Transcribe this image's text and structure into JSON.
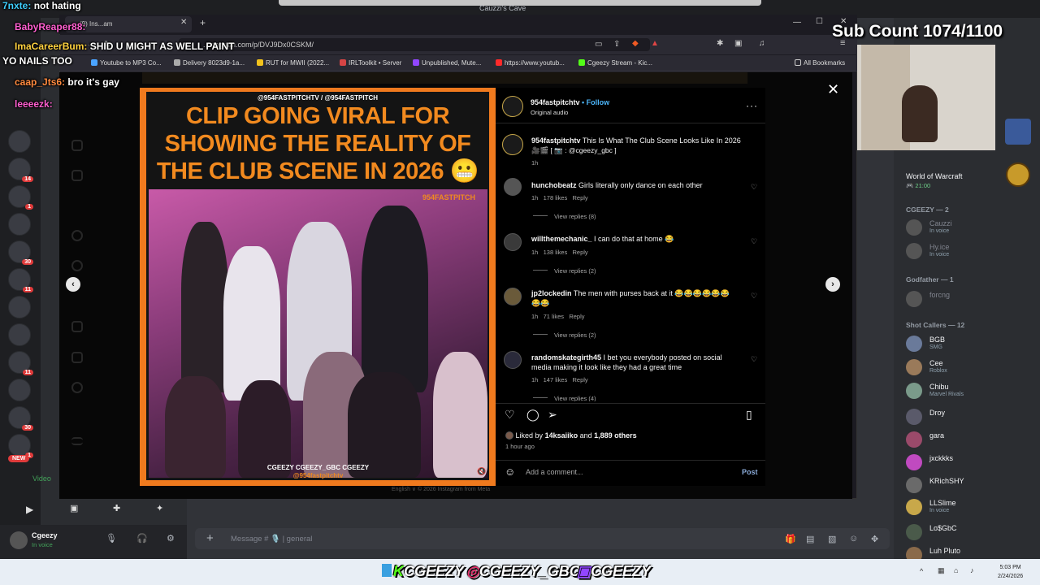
{
  "window": {
    "title": "Cauzzi's Cave"
  },
  "overlay": {
    "sub_count": "Sub Count 1074/1100",
    "chat": [
      {
        "user": "7nxte:",
        "message": "not hating"
      },
      {
        "user": "BabyReaper88:",
        "message": ""
      },
      {
        "user": "ImaCareerBum:",
        "message": "SHID U MIGHT AS WELL PAINT"
      },
      {
        "user": "",
        "message": "YO NAILS TOO"
      },
      {
        "user": "caap_Jts6:",
        "message": "bro it's gay"
      },
      {
        "user": "leeeezk:",
        "message": ""
      }
    ]
  },
  "browser": {
    "tab_title": "(9) Ins...am",
    "url": "...stagram.com/p/DVJ9Dx0CSKM/",
    "bookmarks": [
      "Youtube to MP3 Co...",
      "Delivery 8023d9-1a...",
      "RUT for MWII (2022...",
      "IRLToolkit • Server",
      "Unpublished, Mute...",
      "https://www.youtub...",
      "Cgeezy Stream - Kic..."
    ],
    "all_bookmarks": "All Bookmarks"
  },
  "video": {
    "handles": "@954FASTPITCHTV / @954FASTPITCH",
    "headline": "CLIP GOING VIRAL FOR SHOWING THE REALITY OF THE CLUB SCENE IN 2026 😬",
    "brand": "954FASTPITCH",
    "caption": "CGEEZY  CGEEZY_GBC  CGEEZY",
    "caption2": "@954fastpitchtv"
  },
  "post": {
    "author": "954fastpitchtv",
    "follow_label": "Follow",
    "audio": "Original audio",
    "caption_user": "954fastpitchtv",
    "caption_text": "This Is What The Club Scene Looks Like In 2026",
    "caption_line2": "🎥🎬 [ 📷 : @cgeezy_gbc ]",
    "caption_time": "1h",
    "comments": [
      {
        "user": "hunchobeatz",
        "text": "Girls literally only dance on each other",
        "time": "1h",
        "likes": "178 likes",
        "reply": "Reply",
        "view_replies": "View replies (8)"
      },
      {
        "user": "willthemechanic_",
        "text": "I can do that at home 😂",
        "time": "1h",
        "likes": "138 likes",
        "reply": "Reply",
        "view_replies": "View replies (2)"
      },
      {
        "user": "jp2lockedin",
        "text": "The men with purses back at it 😂😂😂😂😂😂",
        "text2": "😂😂",
        "time": "1h",
        "likes": "71 likes",
        "reply": "Reply",
        "view_replies": "View replies (2)"
      },
      {
        "user": "randomskategirth45",
        "text": "I bet you everybody posted on social",
        "text2": "media making it look like they had a great time",
        "time": "1h",
        "likes": "147 likes",
        "reply": "Reply",
        "view_replies": "View replies (4)"
      }
    ],
    "liked_by_prefix": "Liked by",
    "liked_by_user": "14ksaiiko",
    "liked_by_mid": "and",
    "liked_by_others": "1,889 others",
    "posted_ago": "1 hour ago",
    "comment_placeholder": "Add a comment...",
    "post_label": "Post",
    "footer": "English ∨   © 2026 Instagram from Meta"
  },
  "discord": {
    "game_activity": "World of Warcraft",
    "game_sub": "🎮 21:00",
    "groups": [
      {
        "heading": "CGEEZY — 2",
        "members": [
          {
            "name": "Cauzzi",
            "sub": "In voice"
          },
          {
            "name": "Hy.ice",
            "sub": "In voice"
          }
        ]
      },
      {
        "heading": "Godfather — 1",
        "members": [
          {
            "name": "forcng",
            "sub": ""
          }
        ]
      },
      {
        "heading": "Shot Callers — 12",
        "members": [
          {
            "name": "BGB",
            "sub": "SMG"
          },
          {
            "name": "Cee",
            "sub": "Roblox"
          },
          {
            "name": "Chibu",
            "sub": "Marvel Rivals"
          },
          {
            "name": "Droy",
            "sub": ""
          },
          {
            "name": "gara",
            "sub": ""
          },
          {
            "name": "jxckkks",
            "sub": ""
          },
          {
            "name": "KRichSHY",
            "sub": ""
          },
          {
            "name": "LLSlime",
            "sub": "In voice"
          },
          {
            "name": "Lo$GbC",
            "sub": ""
          },
          {
            "name": "Luh Pluto",
            "sub": ""
          }
        ]
      }
    ],
    "voice_label": "Video",
    "user_name": "Cgeezy",
    "user_status": "In voice",
    "message_placeholder": "Message # 🎙️ | general",
    "new_badge": "NEW"
  },
  "taskbar": {
    "tags": [
      "CGEEZY",
      "CGEEZY_GBC",
      "CGEEZY"
    ],
    "time": "5:03 PM",
    "date": "2/24/2026"
  },
  "colors": {
    "accent_orange": "#f07a1e",
    "ig_blue": "#4cb5f9",
    "discord_bg": "#313338"
  }
}
